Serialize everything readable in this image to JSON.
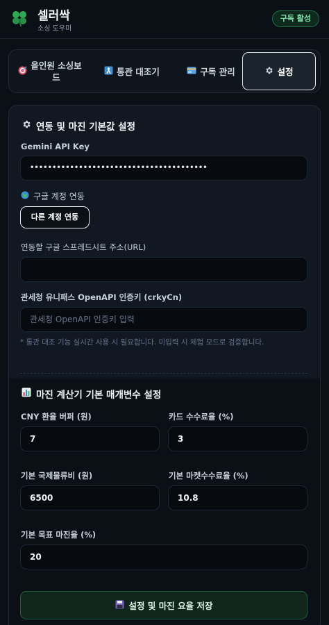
{
  "header": {
    "brand_name": "셀러싹",
    "brand_sub": "소싱 도우미",
    "badge": "구독 활성"
  },
  "tabs": [
    {
      "label": "올인원 소싱보드",
      "icon": "target-icon",
      "active": false
    },
    {
      "label": "통관 대조기",
      "icon": "customs-icon",
      "active": false
    },
    {
      "label": "구독 관리",
      "icon": "credit-card-icon",
      "active": false
    },
    {
      "label": "설정",
      "icon": "gear-icon",
      "active": true
    }
  ],
  "integration": {
    "title": "연동 및 마진 기본값 설정",
    "gemini_label": "Gemini API Key",
    "gemini_value": "••••••••••••••••••••••••••••••••••••••••",
    "google_label": "구글 계정 연동",
    "switch_account": "다른 계정 연동",
    "sheet_label": "연동할 구글 스프레드시트 주소(URL)",
    "sheet_value": "",
    "customs_label": "관세청 유니패스 OpenAPI 인증키 (crkyCn)",
    "customs_placeholder": "관세청 OpenAPI 인증키 입력",
    "note": "* 통관 대조 기능 실시간 사용 시 필요합니다. 미입력 시 체험 모드로 검증합니다."
  },
  "margin": {
    "title": "마진 계산기 기본 매개변수 설정",
    "fields": [
      {
        "label": "CNY 환율 버퍼 (원)",
        "value": "7"
      },
      {
        "label": "카드 수수료율 (%)",
        "value": "3"
      },
      {
        "label": "기본 국제물류비 (원)",
        "value": "6500"
      },
      {
        "label": "기본 마켓수수료율 (%)",
        "value": "10.8"
      },
      {
        "label": "기본 목표 마진율 (%)",
        "value": "20"
      }
    ]
  },
  "save_button": "설정 및 마진 요율 저장",
  "colors": {
    "background": "#0b1016",
    "card": "#111821",
    "accent_green": "#7fe3a8",
    "save_bg": "#10261c"
  }
}
